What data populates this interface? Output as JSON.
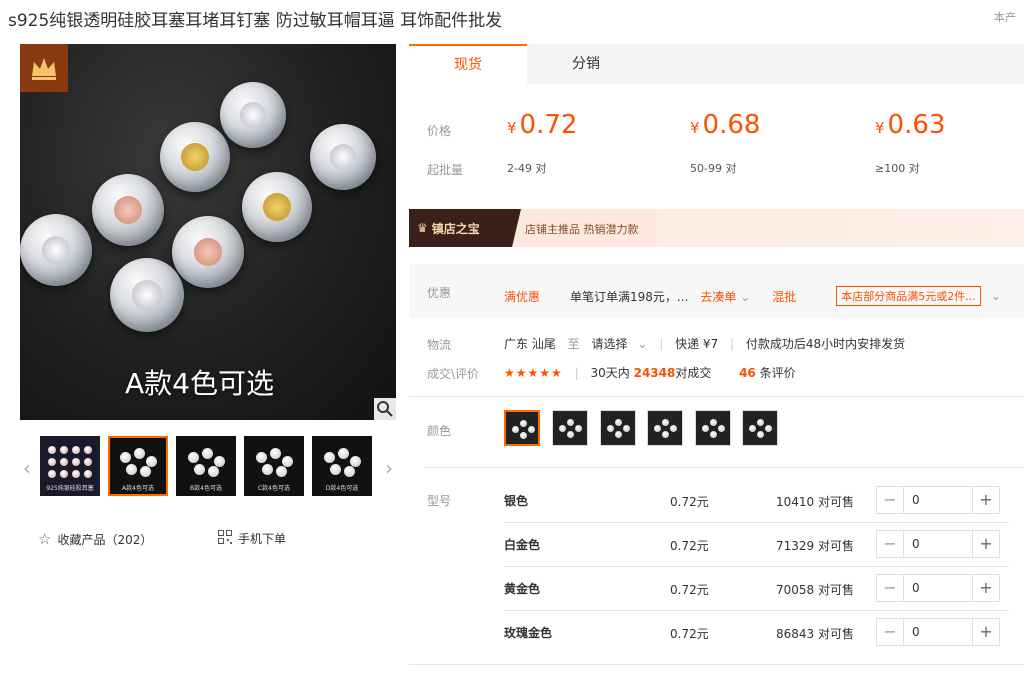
{
  "title": "s925纯银透明硅胶耳塞耳堵耳钉塞 防过敏耳帽耳逼 耳饰配件批发",
  "top_right_note": "本产",
  "main_image": {
    "caption": "A款4色可选"
  },
  "thumbnails": [
    {
      "caption": "925纯银硅胶耳塞"
    },
    {
      "caption": "A款4色可选"
    },
    {
      "caption": "B款4色可选"
    },
    {
      "caption": "C款4色可选"
    },
    {
      "caption": "D款4色可选"
    }
  ],
  "actions": {
    "favorite_label": "收藏产品（202）",
    "mobile_label": "手机下单"
  },
  "tabs": [
    {
      "label": "现货"
    },
    {
      "label": "分销"
    }
  ],
  "price": {
    "price_label": "价格",
    "moq_label": "起批量",
    "currency": "¥",
    "tiers": [
      {
        "price": "0.72",
        "qty": "2-49 对"
      },
      {
        "price": "0.68",
        "qty": "50-99 对"
      },
      {
        "price": "0.63",
        "qty": "≥100 对"
      }
    ]
  },
  "treasure": {
    "badge": "镇店之宝",
    "tags": "店铺主推品  热销潜力款"
  },
  "promo": {
    "label": "优惠",
    "tag": "满优惠",
    "text": "单笔订单满198元，...",
    "link": "去凑单",
    "mix": "混批",
    "coupon": "本店部分商品满5元或2件..."
  },
  "logistics": {
    "label": "物流",
    "origin": "广东 汕尾",
    "to": "至",
    "dest": "请选择",
    "express": "快递 ¥7",
    "ship_note": "付款成功后48小时内安排发货"
  },
  "deals": {
    "label": "成交\\评价",
    "stars": "★★★★★",
    "days_prefix": "30天内",
    "deal_count": "24348",
    "deal_suffix": "对成交",
    "review_count": "46",
    "review_suffix": "条评价"
  },
  "colors_label": "颜色",
  "model_label": "型号",
  "models": [
    {
      "name": "银色",
      "price": "0.72元",
      "stock": "10410 对可售",
      "qty": "0"
    },
    {
      "name": "白金色",
      "price": "0.72元",
      "stock": "71329 对可售",
      "qty": "0"
    },
    {
      "name": "黄金色",
      "price": "0.72元",
      "stock": "70058 对可售",
      "qty": "0"
    },
    {
      "name": "玫瑰金色",
      "price": "0.72元",
      "stock": "86843 对可售",
      "qty": "0"
    }
  ],
  "accent_color": "#ff5000"
}
